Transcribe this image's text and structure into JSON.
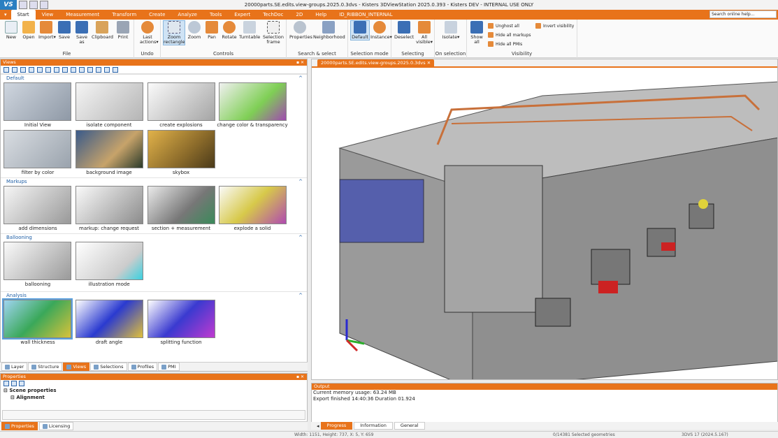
{
  "window": {
    "title": "20000parts.SE.edits.view-groups.2025.0.3dvs - Kisters 3DViewStation 2025.0.393 - Kisters DEV - INTERNAL USE ONLY",
    "logo": "VS"
  },
  "ribbon": {
    "tabs": [
      "Start",
      "View",
      "Measurement",
      "Transform",
      "Create",
      "Analyze",
      "Tools",
      "Expert",
      "TechDoc",
      "2D",
      "Help",
      "ID_RIBBON_INTERNAL"
    ],
    "active_tab": "Start",
    "search_placeholder": "Search online help...",
    "groups": {
      "file": {
        "label": "File",
        "buttons": [
          "New",
          "Open",
          "Import",
          "Save",
          "Save as",
          "Clipboard",
          "Print"
        ]
      },
      "undo": {
        "label": "Undo",
        "buttons": [
          "Last actions"
        ]
      },
      "controls": {
        "label": "Controls",
        "buttons": [
          "Zoom rectangle",
          "Zoom",
          "Pan",
          "Rotate",
          "Turntable",
          "Selection frame"
        ]
      },
      "search_select": {
        "label": "Search & select",
        "buttons": [
          "Properties",
          "Neighborhood"
        ]
      },
      "selection_mode": {
        "label": "Selection mode",
        "buttons": [
          "Default",
          "Instance"
        ]
      },
      "selecting": {
        "label": "Selecting",
        "buttons": [
          "Deselect",
          "All visible"
        ]
      },
      "on_selection": {
        "label": "On selection",
        "buttons": [
          "Isolate"
        ]
      },
      "visibility": {
        "label": "Visibility",
        "buttons": [
          "Show all"
        ],
        "small": [
          "Unghost all",
          "Hide all markups",
          "Hide all PMIs",
          "Invert visibility"
        ]
      }
    }
  },
  "views_panel": {
    "title": "Views",
    "sections": [
      {
        "name": "Default",
        "items": [
          "Initial View",
          "isolate component",
          "create explosions",
          "change color & transparency",
          "filter by color",
          "background image",
          "skybox"
        ]
      },
      {
        "name": "Markups",
        "items": [
          "add dimensions",
          "markup: change request",
          "section + measurement",
          "explode a solid"
        ]
      },
      {
        "name": "Ballooning",
        "items": [
          "ballooning",
          "illustration mode"
        ]
      },
      {
        "name": "Analysis",
        "items": [
          "wall thickness",
          "draft angle",
          "splitting function"
        ]
      }
    ],
    "tabs": [
      "Layer",
      "Structure",
      "Views",
      "Selections",
      "Profiles",
      "PMI"
    ],
    "active_tab": "Views"
  },
  "properties_panel": {
    "title": "Properties",
    "rows": [
      "Scene properties",
      "Alignment"
    ],
    "tabs": [
      "Properties",
      "Licensing"
    ]
  },
  "viewport": {
    "doc_tab": "20000parts.SE.edits.view-groups.2025.0.3dvs"
  },
  "output": {
    "title": "Output",
    "lines": [
      "Current memory usage: 63.24 MB",
      "Export finished 14:40:36 Duration 01.924"
    ],
    "tabs": [
      "Progress",
      "Information",
      "General"
    ],
    "active_tab": "Progress"
  },
  "status": {
    "size": "Width: 1151, Height: 737, X: 5, Y: 659",
    "selected": "0/14381 Selected geometries",
    "version": "3DVS 17 (2024.5.167)"
  },
  "colors": {
    "accent": "#e8731a",
    "selection": "#5aa0dc"
  }
}
